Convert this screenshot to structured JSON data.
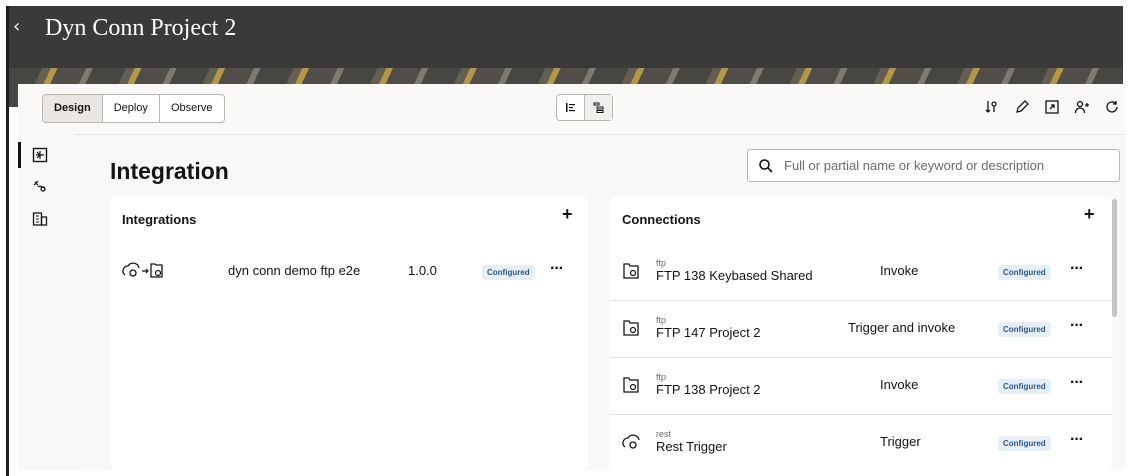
{
  "app": {
    "title": "Dyn Conn Project 2",
    "back_label": "‹"
  },
  "tabs": [
    "Design",
    "Deploy",
    "Observe"
  ],
  "page_title": "Integration",
  "search": {
    "placeholder": "Full or partial name or keyword or description"
  },
  "integrations": {
    "title": "Integrations",
    "add_label": "+",
    "items": [
      {
        "name": "dyn conn demo ftp e2e",
        "version": "1.0.0",
        "status": "Configured",
        "menu": "···"
      }
    ]
  },
  "connections": {
    "title": "Connections",
    "add_label": "+",
    "items": [
      {
        "type": "ftp",
        "name": "FTP 138 Keybased Shared",
        "role": "Invoke",
        "status": "Configured",
        "menu": "···"
      },
      {
        "type": "ftp",
        "name": "FTP 147 Project 2",
        "role": "Trigger and invoke",
        "status": "Configured",
        "menu": "···"
      },
      {
        "type": "ftp",
        "name": "FTP 138 Project 2",
        "role": "Invoke",
        "status": "Configured",
        "menu": "···"
      },
      {
        "type": "rest",
        "name": "Rest Trigger",
        "role": "Trigger",
        "status": "Configured",
        "menu": "···"
      }
    ]
  },
  "icons": {
    "toolbar": [
      "sort-icon",
      "edit-icon",
      "export-icon",
      "share-icon",
      "refresh-icon"
    ],
    "leftnav": [
      "integrations-icon",
      "connections-icon",
      "lookups-icon"
    ]
  },
  "colors": {
    "header_bg": "#3b3a38",
    "badge_bg": "#e8eef5",
    "badge_text": "#2c5a87"
  }
}
